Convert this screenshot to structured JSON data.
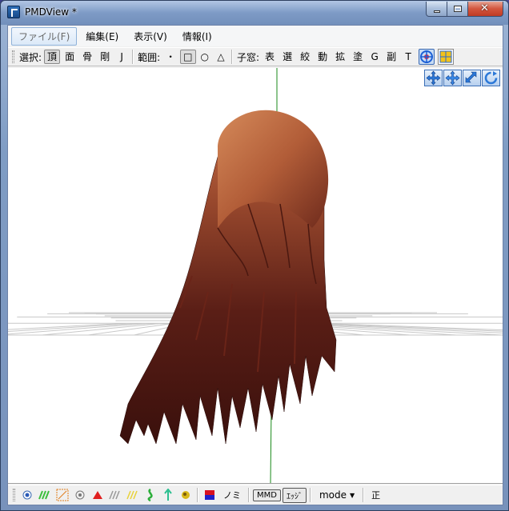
{
  "window": {
    "title": "PMDView *"
  },
  "menu": [
    {
      "label": "ファイル(F)",
      "active": true
    },
    {
      "label": "編集(E)"
    },
    {
      "label": "表示(V)"
    },
    {
      "label": "情報(I)"
    }
  ],
  "toolbar": {
    "select_label": "選択:",
    "select_items": [
      "頂",
      "面",
      "骨",
      "剛",
      "J"
    ],
    "range_label": "範囲:",
    "range_items": [
      "・",
      "□",
      "○",
      "△"
    ],
    "child_label": "子窓:",
    "child_items": [
      "表",
      "選",
      "絞",
      "動",
      "拡",
      "塗",
      "G",
      "副",
      "T"
    ]
  },
  "status": {
    "no_label": "ノミ",
    "md_label": "MMD",
    "edge_label": "ｴｯｼﾞ",
    "mode_label": "mode",
    "front_label": "正"
  },
  "icons": {
    "view_move": "move-arrows-icon",
    "view_pan": "pan-arrows-icon",
    "view_zoom": "zoom-arrow-icon",
    "view_rotate": "rotate-icon"
  },
  "colors": {
    "accent": "#2d6bb8",
    "grid": "#c8c8c8",
    "axis": "#1a8a1a",
    "hair_light": "#c46a45",
    "hair_dark": "#3c1410"
  }
}
